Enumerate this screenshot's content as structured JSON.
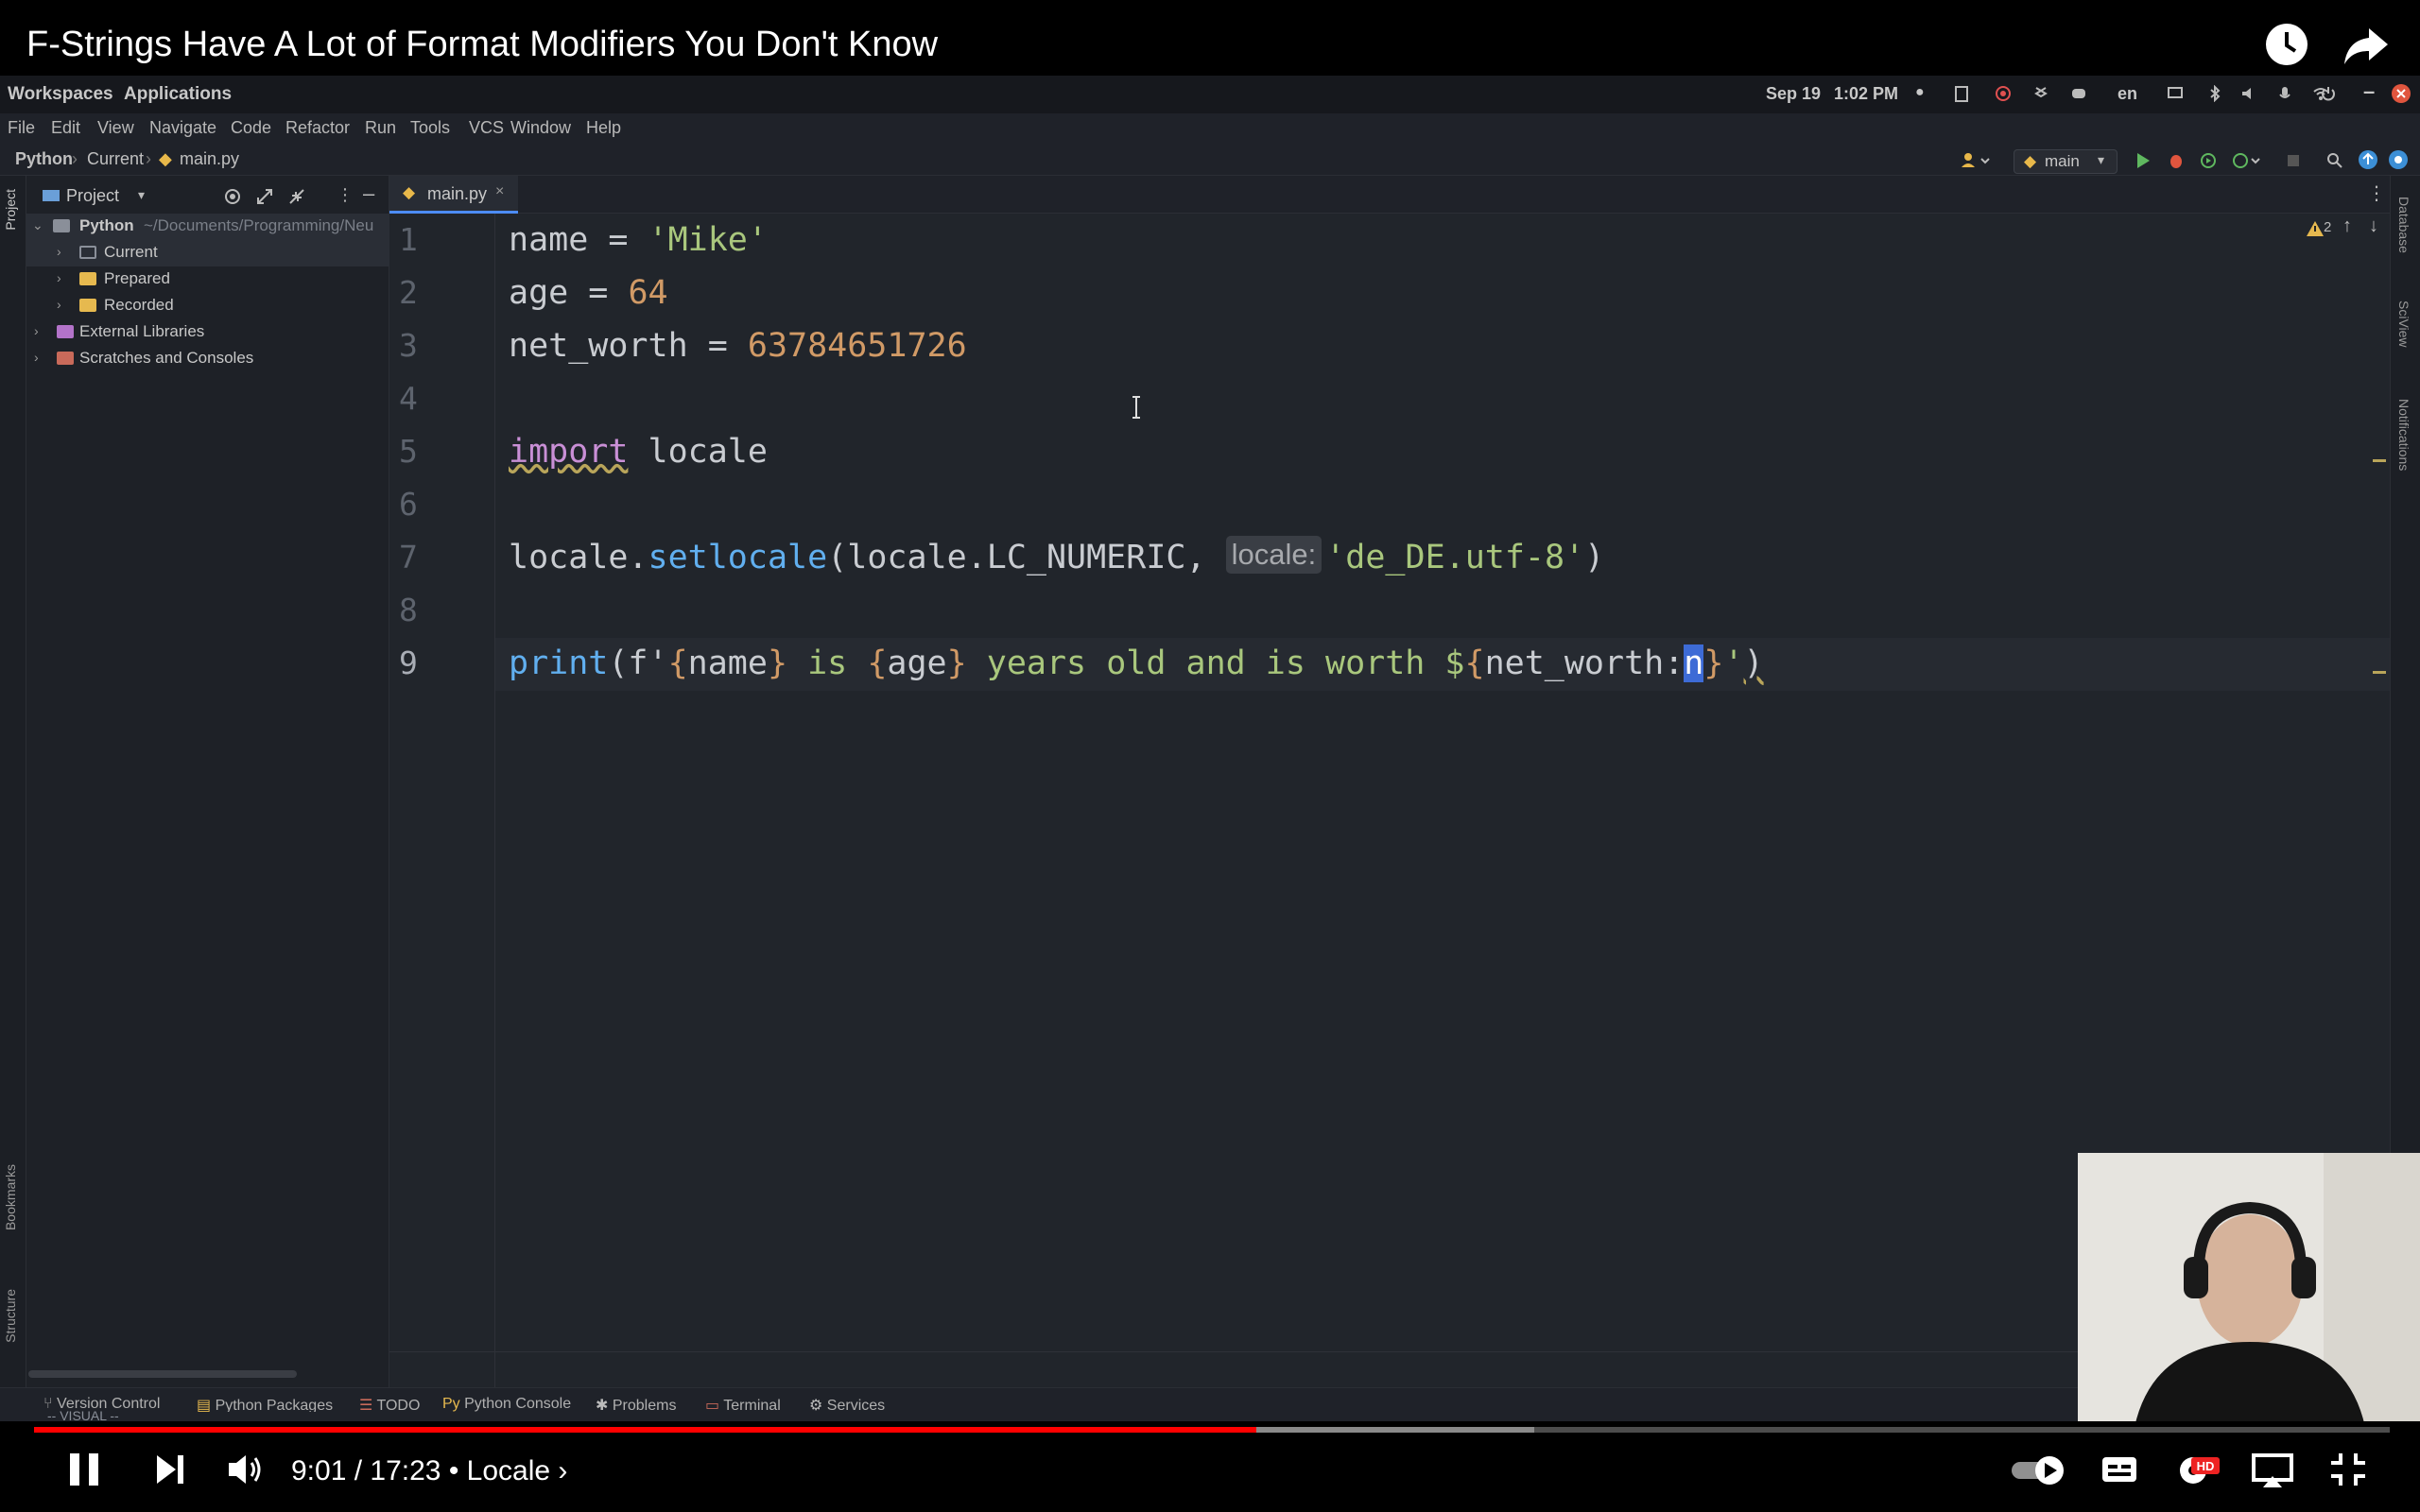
{
  "video": {
    "title": "F-Strings Have A Lot of Format Modifiers You Don't Know",
    "time_current": "9:01",
    "time_total": "17:23",
    "chapter": "Locale",
    "progress_fraction": 0.5187
  },
  "desktop": {
    "workspaces": "Workspaces",
    "applications": "Applications",
    "date": "Sep 19",
    "time": "1:02 PM",
    "lang": "en"
  },
  "menu": [
    "File",
    "Edit",
    "View",
    "Navigate",
    "Code",
    "Refactor",
    "Run",
    "Tools",
    "VCS",
    "Window",
    "Help"
  ],
  "breadcrumb": [
    "Python",
    "Current",
    "main.py"
  ],
  "branch": "main",
  "project": {
    "title": "Project",
    "root_name": "Python",
    "root_path": "~/Documents/Programming/Neu",
    "children": [
      "Current",
      "Prepared",
      "Recorded"
    ],
    "external": "External Libraries",
    "scratches": "Scratches and Consoles"
  },
  "editor": {
    "tab": "main.py",
    "warnings": "2",
    "line_numbers": [
      "1",
      "2",
      "3",
      "4",
      "5",
      "6",
      "7",
      "8",
      "9"
    ],
    "code": {
      "l1_a": "name = ",
      "l1_b": "'Mike'",
      "l2_a": "age = ",
      "l2_b": "64",
      "l3_a": "net_worth = ",
      "l3_b": "63784651726",
      "l5_a": "import",
      "l5_b": " locale",
      "l7_a": "locale.",
      "l7_b": "setlocale",
      "l7_c": "(locale.LC_NUMERIC, ",
      "l7_hint": "locale:",
      "l7_d": "'de_DE.utf-8'",
      "l7_e": ")",
      "l9_a": "print",
      "l9_b": "(f'",
      "l9_c": "{",
      "l9_d": "name",
      "l9_e": "}",
      "l9_f": " is ",
      "l9_g": "{",
      "l9_h": "age",
      "l9_i": "}",
      "l9_j": " years old and is worth $",
      "l9_k": "{",
      "l9_l": "net_worth:",
      "l9_m": "n",
      "l9_n": "}",
      "l9_o": "'",
      "l9_p": ")"
    }
  },
  "left_strip": [
    "Project",
    "Bookmarks",
    "Structure"
  ],
  "right_strip": [
    "Database",
    "SciView",
    "Notifications"
  ],
  "bottom_tools": [
    "Version Control",
    "Python Packages",
    "TODO",
    "Python Console",
    "Problems",
    "Terminal",
    "Services"
  ],
  "vim_status": "-- VISUAL --"
}
